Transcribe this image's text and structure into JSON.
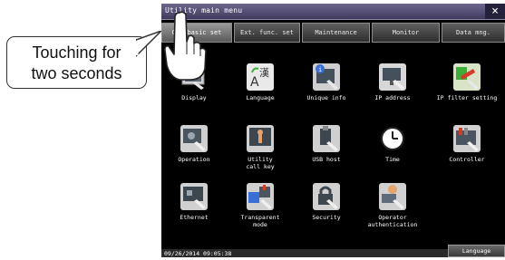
{
  "callout": {
    "line1": "Touching for",
    "line2": "two seconds"
  },
  "window": {
    "title": "Utility main menu",
    "close_glyph": "×"
  },
  "tabs": [
    {
      "label": "GOT basic set",
      "active": true
    },
    {
      "label": "Ext. func. set",
      "active": false
    },
    {
      "label": "Maintenance",
      "active": false
    },
    {
      "label": "Monitor",
      "active": false
    },
    {
      "label": "Data mng.",
      "active": false
    }
  ],
  "items": [
    {
      "label": "Display",
      "icon": "display-icon"
    },
    {
      "label": "Language",
      "icon": "language-icon"
    },
    {
      "label": "Unique info",
      "icon": "unique-info-icon"
    },
    {
      "label": "IP address",
      "icon": "ip-address-icon"
    },
    {
      "label": "IP filter setting",
      "icon": "ip-filter-icon"
    },
    {
      "label": "Operation",
      "icon": "operation-icon"
    },
    {
      "label": "Utility\ncall key",
      "icon": "utility-call-key-icon"
    },
    {
      "label": "USB host",
      "icon": "usb-host-icon"
    },
    {
      "label": "Time",
      "icon": "clock-icon"
    },
    {
      "label": "Controller",
      "icon": "controller-icon"
    },
    {
      "label": "Ethernet",
      "icon": "ethernet-icon"
    },
    {
      "label": "Transparent\nmode",
      "icon": "transparent-mode-icon"
    },
    {
      "label": "Security",
      "icon": "security-icon"
    },
    {
      "label": "Operator\nauthentication",
      "icon": "operator-auth-icon"
    }
  ],
  "status": {
    "datetime": "09/26/2014 09:05:38",
    "language_button": "Language"
  },
  "colors": {
    "screen_bg": "#000000",
    "title_bar": "#4e4870",
    "accent_red": "#d83a2a",
    "accent_blue": "#3a6fd8"
  }
}
